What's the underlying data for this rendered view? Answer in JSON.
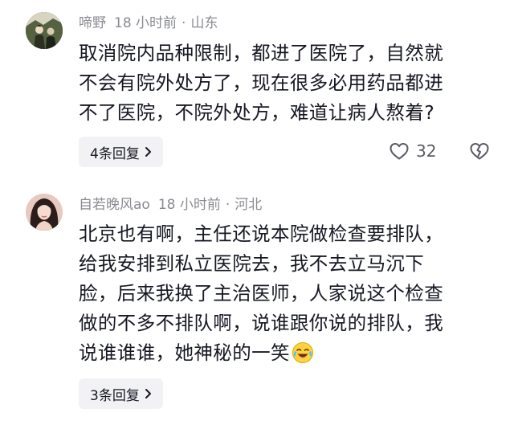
{
  "comments": [
    {
      "username": "啼野",
      "time": "18 小时前",
      "separator": "·",
      "location": "山东",
      "lines": [
        "取消院内品种限制，都进了医院了，自然就",
        "不会有院外处方了，现在很多必用药品都进",
        "不了医院，不院外处方，难道让病人熬着?"
      ],
      "replies_label": "4条回复",
      "likes": "32",
      "avatar_icon": "avatar-dark-photo",
      "colors": {
        "avatar_bg": "#3f4a2e"
      }
    },
    {
      "username": "自若晚风ao",
      "time": "18 小时前",
      "separator": "·",
      "location": "河北",
      "lines": [
        "北京也有啊，主任还说本院做检查要排队，",
        "给我安排到私立医院去，我不去立马沉下",
        "脸，后来我换了主治医师，人家说这个检查",
        "做的不多不排队啊，说谁跟你说的排队，我",
        "说谁谁谁，她神秘的一笑"
      ],
      "replies_label": "3条回复",
      "emoji": "laugh-cry-emoji",
      "avatar_icon": "avatar-woman-photo",
      "colors": {
        "avatar_bg": "#e7c9c0"
      }
    }
  ],
  "icons": {
    "reply_chevron": "chevron-right-icon",
    "like": "heart-outline-icon",
    "dislike": "broken-heart-icon"
  }
}
